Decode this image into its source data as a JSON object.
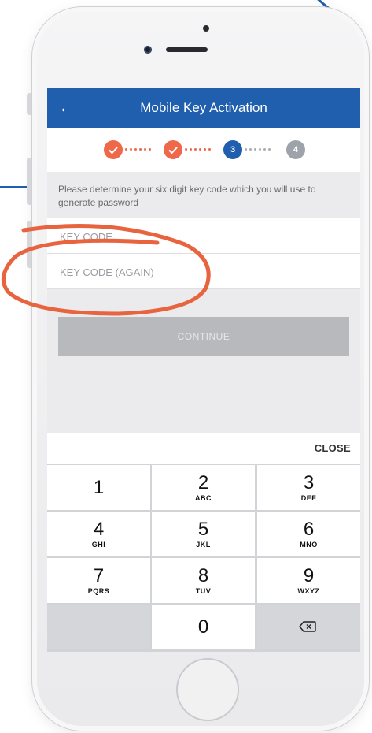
{
  "app_bar": {
    "title": "Mobile Key Activation"
  },
  "steps": [
    {
      "label": "",
      "state": "done"
    },
    {
      "label": "",
      "state": "done"
    },
    {
      "label": "3",
      "state": "active"
    },
    {
      "label": "4",
      "state": "todo"
    }
  ],
  "instructions": "Please determine your six digit key code which you will use to generate password",
  "fields": {
    "key_code_placeholder": "KEY CODE",
    "key_code_again_placeholder": "KEY CODE (AGAIN)"
  },
  "continue_label": "CONTINUE",
  "keypad": {
    "close_label": "CLOSE",
    "keys": [
      {
        "num": "1",
        "sub": ""
      },
      {
        "num": "2",
        "sub": "ABC"
      },
      {
        "num": "3",
        "sub": "DEF"
      },
      {
        "num": "4",
        "sub": "GHI"
      },
      {
        "num": "5",
        "sub": "JKL"
      },
      {
        "num": "6",
        "sub": "MNO"
      },
      {
        "num": "7",
        "sub": "PQRS"
      },
      {
        "num": "8",
        "sub": "TUV"
      },
      {
        "num": "9",
        "sub": "WXYZ"
      },
      {
        "num": "0",
        "sub": ""
      }
    ]
  },
  "colors": {
    "brand_blue": "#1f5fae",
    "step_done": "#f0684a",
    "step_todo": "#9ea3ab",
    "annotation": "#e8643f"
  },
  "icons": {
    "back": "arrow-left-icon",
    "check": "check-icon",
    "backspace": "backspace-icon"
  }
}
